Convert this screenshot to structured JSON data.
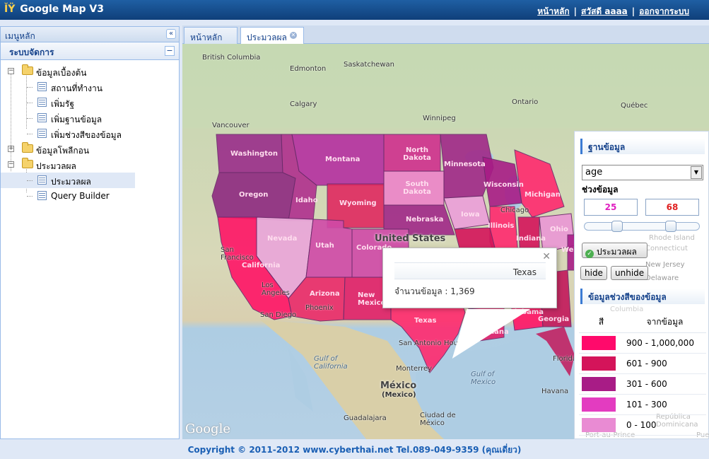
{
  "header": {
    "title": "Google Map V3",
    "links": [
      "หน้าหลัก",
      "สวัสดี aaaa",
      "ออกจากระบบ"
    ]
  },
  "sidebar": {
    "title": "เมนูหลัก",
    "section": "ระบบจัดการ",
    "tree": [
      {
        "label": "ข้อมูลเบื้องต้น",
        "type": "folder",
        "expanded": true
      },
      {
        "label": "สถานที่ทำงาน",
        "type": "doc"
      },
      {
        "label": "เพิ่มรัฐ",
        "type": "doc"
      },
      {
        "label": "เพิ่มฐานข้อมูล",
        "type": "doc"
      },
      {
        "label": "เพิ่มช่วงสีของข้อมูล",
        "type": "doc"
      },
      {
        "label": "ข้อมูลโพลีกอน",
        "type": "folder",
        "expanded": false
      },
      {
        "label": "ประมวลผล",
        "type": "folder",
        "expanded": true
      },
      {
        "label": "ประมวลผล",
        "type": "doc",
        "selected": true
      },
      {
        "label": "Query Builder",
        "type": "doc"
      }
    ]
  },
  "tabs": [
    {
      "label": "หน้าหลัก"
    },
    {
      "label": "ประมวลผล",
      "active": true
    }
  ],
  "map": {
    "place_labels": [
      "British Columbia",
      "Edmonton",
      "Saskatchewan",
      "Calgary",
      "Ontario",
      "Québec",
      "Winnipeg",
      "Vancouver",
      "Chicago",
      "San Francisco",
      "Los Angeles",
      "San Diego",
      "Phoenix",
      "San Antonio",
      "Houston",
      "Monterrey",
      "Gulf of California",
      "Gulf of Mexico",
      "Guadalajara",
      "Ciudad de México",
      "Havana",
      "Florida",
      "Rhode Island",
      "Connecticut",
      "New Jersey",
      "Delaware",
      "Columbia",
      "República Dominicana",
      "Port-au-Prince",
      "Puer"
    ],
    "state_labels": [
      "Washington",
      "Oregon",
      "Idaho",
      "Montana",
      "Wyoming",
      "Nevada",
      "Utah",
      "Colorado",
      "California",
      "Arizona",
      "New Mexico",
      "Texas",
      "North Dakota",
      "South Dakota",
      "Nebraska",
      "Minnesota",
      "Iowa",
      "Wisconsin",
      "Michigan",
      "Illinois",
      "Indiana",
      "Ohio",
      "Alabama",
      "Georgia",
      "Louisiana",
      "West"
    ],
    "country_labels": [
      "United States",
      "México",
      "(Mexico)"
    ],
    "logo": "Google"
  },
  "infowindow": {
    "state": "Texas",
    "count_text": "จำนวนข้อมูล : 1,369"
  },
  "control_panel": {
    "db_heading": "ฐานข้อมูล",
    "db_value": "age",
    "range_label": "ช่วงข้อมูล",
    "range_min": "25",
    "range_max": "68",
    "process_label": "ประมวลผล",
    "hide_label": "hide",
    "unhide_label": "unhide",
    "legend_heading": "ข้อมูลช่วงสีของข้อมูล",
    "legend_col_color": "สี",
    "legend_col_range": "จากข้อมูล",
    "legend": [
      {
        "range": "900 - 1,000,000",
        "color": "#ff0a6b"
      },
      {
        "range": "601 - 900",
        "color": "#d4145a"
      },
      {
        "range": "301 - 600",
        "color": "#a81c86"
      },
      {
        "range": "101 - 300",
        "color": "#e33cc0"
      },
      {
        "range": "0 - 100",
        "color": "#e98bd3"
      }
    ]
  },
  "footer": "Copyright © 2011-2012 www.cyberthai.net Tel.089-049-9359 (คุณเดี่ยว)"
}
